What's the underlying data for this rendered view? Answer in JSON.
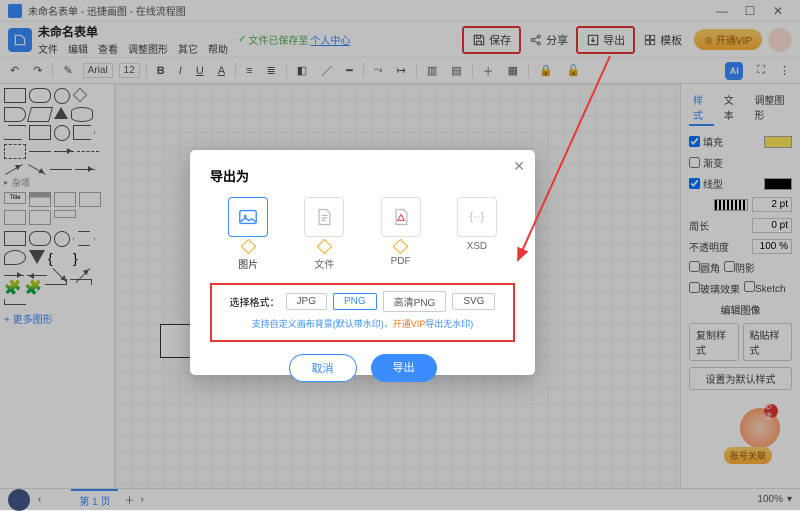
{
  "titlebar": {
    "text": "未命名表单 - 迅捷画图 - 在线流程图"
  },
  "doc": {
    "title": "未命名表单"
  },
  "menubar": [
    "文件",
    "编辑",
    "查看",
    "调整图形",
    "其它",
    "帮助"
  ],
  "save_status": {
    "icon": "✓",
    "text": "文件已保存至",
    "link": "个人中心"
  },
  "header_buttons": {
    "save": "保存",
    "share": "分享",
    "export": "导出",
    "template": "模板",
    "vip": "开通VIP"
  },
  "toolbar": {
    "font": "Arial",
    "font_size": "12",
    "ai": "AI"
  },
  "left_panel": {
    "section_misc": "杂项",
    "more": "+ 更多图形"
  },
  "right_panel": {
    "tabs": [
      "样式",
      "文本",
      "调整图形"
    ],
    "active_tab": 0,
    "fill_label": "填充",
    "gradient_label": "渐变",
    "line_label": "线型",
    "line_pt": "2 pt",
    "line_px": "0 pt",
    "period_label": "周长",
    "opacity_label": "不透明度",
    "opacity_value": "100 %",
    "round_label": "圆角",
    "shadow_label": "阴影",
    "glass_label": "玻璃效果",
    "sketch_label": "Sketch",
    "edit_img": "编辑图像",
    "copy_style": "复制样式",
    "paste_style": "粘贴样式",
    "default_style": "设置为默认样式"
  },
  "statusbar": {
    "page": "第 1 页",
    "zoom": "100%"
  },
  "modal": {
    "title": "导出为",
    "types": [
      "图片",
      "文件",
      "PDF",
      "XSD"
    ],
    "format_label": "选择格式：",
    "formats": [
      "JPG",
      "PNG",
      "高清PNG",
      "SVG"
    ],
    "selected_format": 1,
    "tip_a": "支持自定义画布背景(默认带水印)，",
    "tip_b": "开通VIP",
    "tip_c": "导出无水印)",
    "cancel": "取消",
    "ok": "导出"
  },
  "badge": {
    "label": "账号关联",
    "balloon": "必读"
  }
}
